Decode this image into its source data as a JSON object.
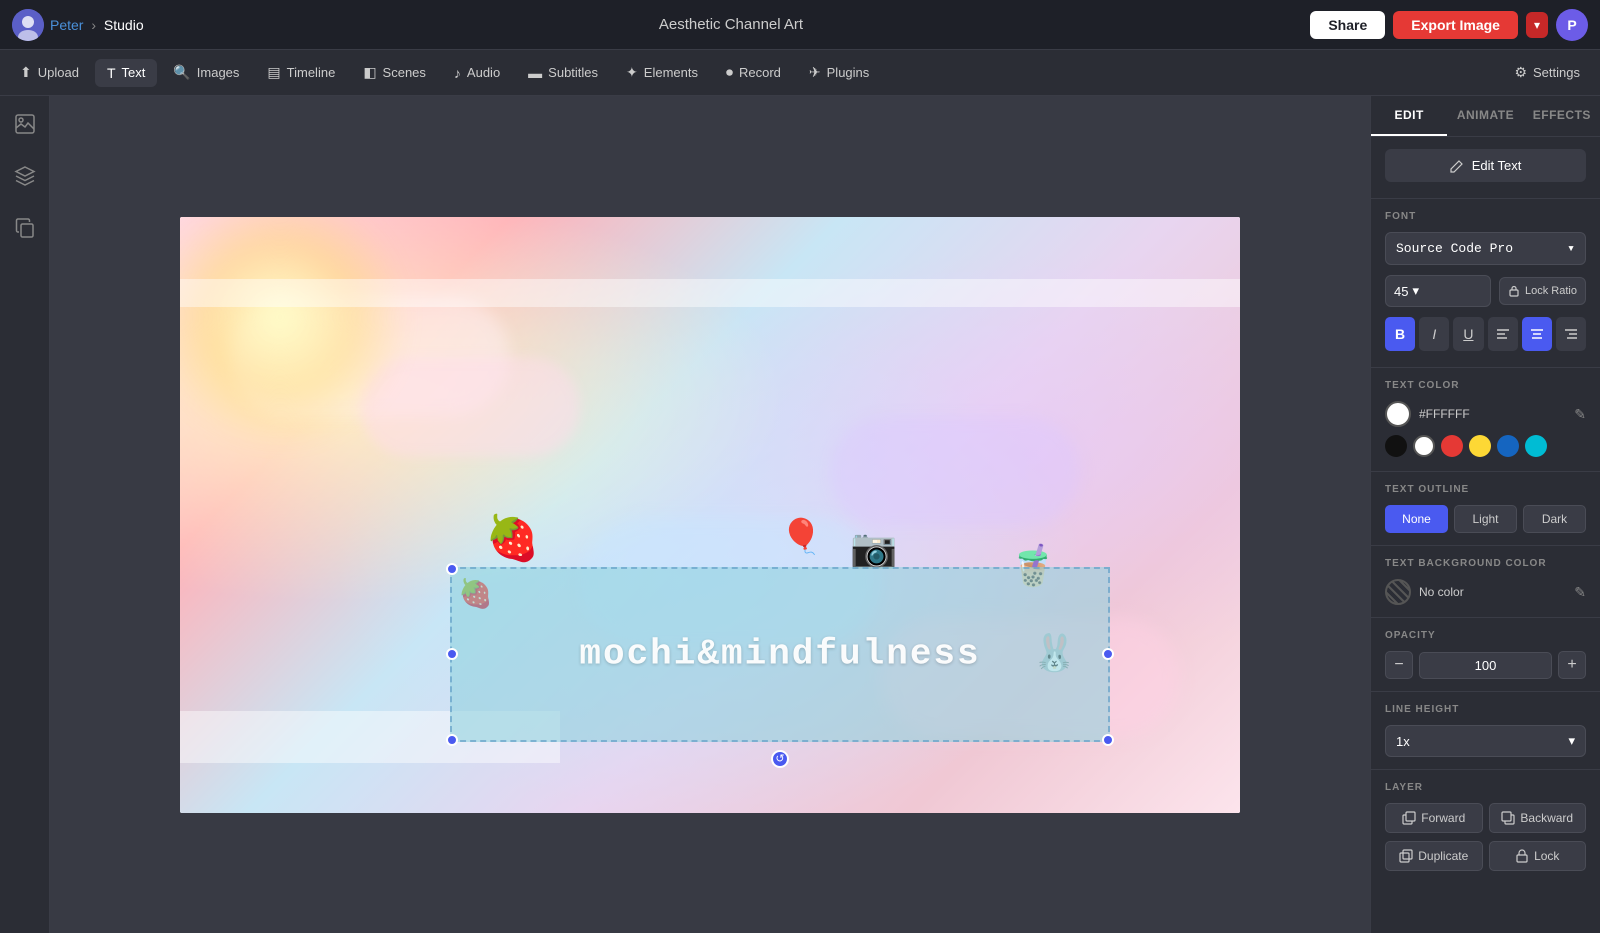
{
  "topbar": {
    "user_name": "Peter",
    "breadcrumb_separator": "›",
    "studio_label": "Studio",
    "title": "Aesthetic Channel Art",
    "share_label": "Share",
    "export_label": "Export Image",
    "user_initial": "P"
  },
  "toolbar": {
    "upload_label": "Upload",
    "text_label": "Text",
    "images_label": "Images",
    "timeline_label": "Timeline",
    "scenes_label": "Scenes",
    "audio_label": "Audio",
    "subtitles_label": "Subtitles",
    "elements_label": "Elements",
    "record_label": "Record",
    "plugins_label": "Plugins",
    "settings_label": "Settings"
  },
  "right_panel": {
    "tabs": [
      "EDIT",
      "ANIMATE",
      "EFFECTS"
    ],
    "active_tab": "EDIT",
    "edit_text_label": "Edit Text",
    "font_section_label": "FONT",
    "font_name": "Source Code Pro",
    "font_size": "45",
    "lock_ratio_label": "Lock Ratio",
    "text_color_label": "TEXT COLOR",
    "text_color_hex": "#FFFFFF",
    "text_outline_label": "TEXT OUTLINE",
    "outline_options": [
      "None",
      "Light",
      "Dark"
    ],
    "active_outline": "None",
    "text_bg_label": "TEXT BACKGROUND COLOR",
    "no_color_label": "No color",
    "opacity_label": "OPACITY",
    "opacity_value": "100",
    "line_height_label": "LINE HEIGHT",
    "line_height_value": "1x",
    "layer_label": "LAYER",
    "forward_label": "Forward",
    "backward_label": "Backward",
    "duplicate_label": "Duplicate",
    "lock_label": "Lock"
  },
  "canvas": {
    "text_content": "mochi&mindfulness"
  }
}
